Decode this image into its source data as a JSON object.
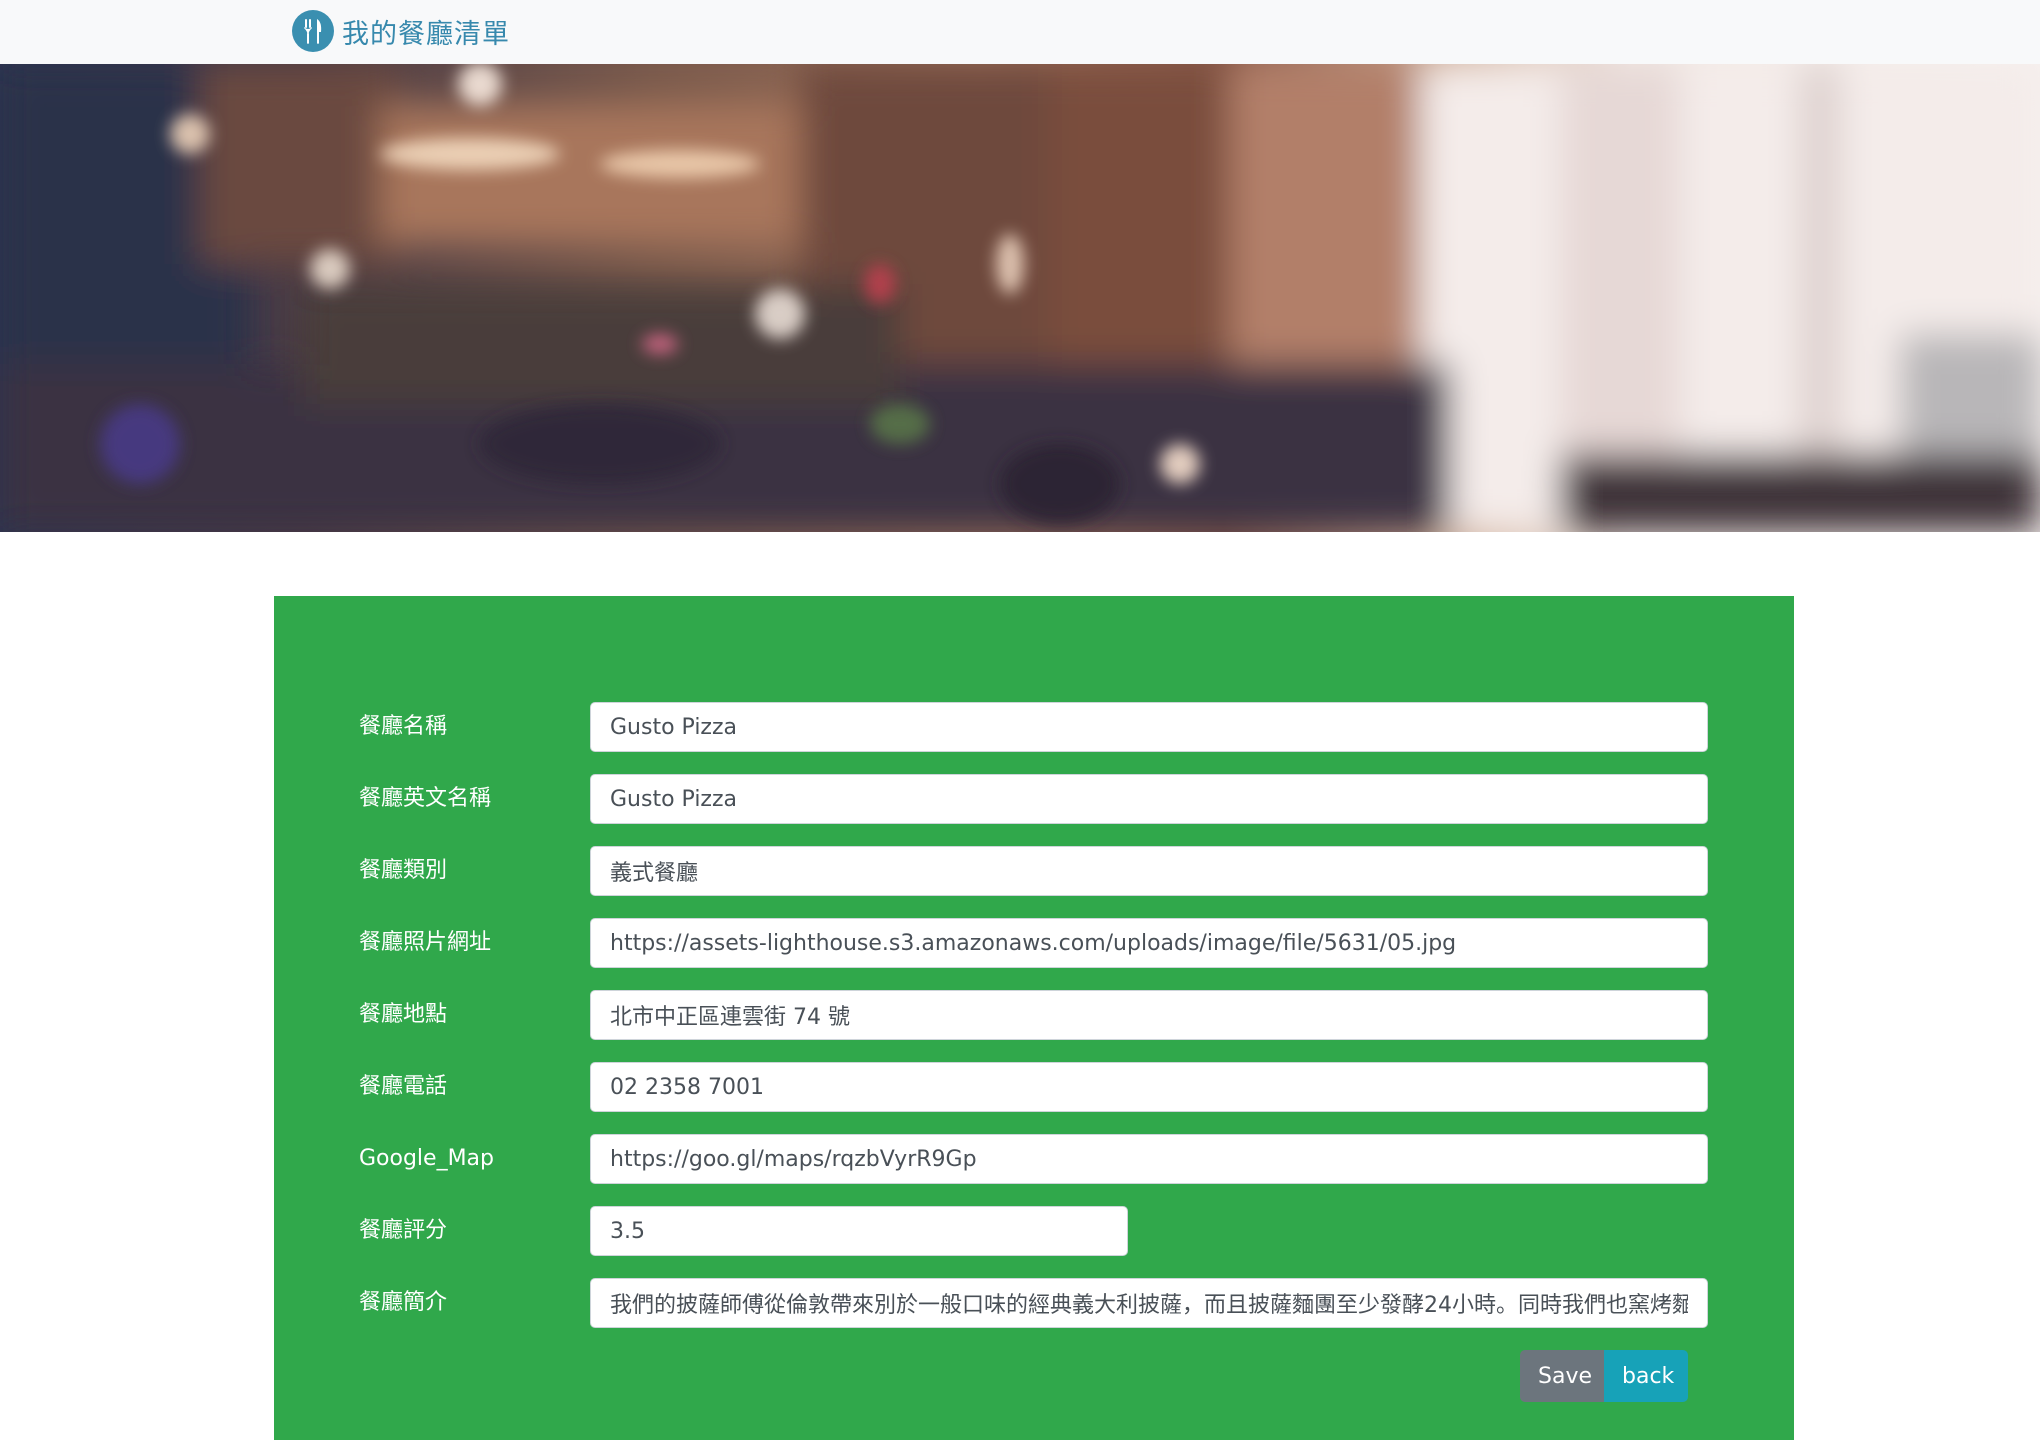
{
  "navbar": {
    "brand_text": "我的餐廳清單",
    "brand_icon": "utensils-icon",
    "brand_color": "#3789ad"
  },
  "banner": {
    "description_icon": "restaurant-banner-image"
  },
  "colors": {
    "panel": "#30a84b",
    "save_button": "#6c757d",
    "back_button": "#17a2b8"
  },
  "form": {
    "fields": [
      {
        "label": "餐廳名稱",
        "value": "Gusto Pizza"
      },
      {
        "label": "餐廳英文名稱",
        "value": "Gusto Pizza"
      },
      {
        "label": "餐廳類別",
        "value": "義式餐廳"
      },
      {
        "label": "餐廳照片網址",
        "value": "https://assets-lighthouse.s3.amazonaws.com/uploads/image/file/5631/05.jpg"
      },
      {
        "label": "餐廳地點",
        "value": "北市中正區連雲街 74 號"
      },
      {
        "label": "餐廳電話",
        "value": "02 2358 7001"
      },
      {
        "label": "Google_Map",
        "value": "https://goo.gl/maps/rqzbVyrR9Gp"
      },
      {
        "label": "餐廳評分",
        "value": "3.5"
      },
      {
        "label": "餐廳簡介",
        "value": "我們的披薩師傅從倫敦帶來別於一般口味的經典義大利披薩，而且披薩麵團至少發酵24小時。同時我們也窯烤麵包及"
      }
    ],
    "save_label": "Save",
    "back_label": "back"
  }
}
